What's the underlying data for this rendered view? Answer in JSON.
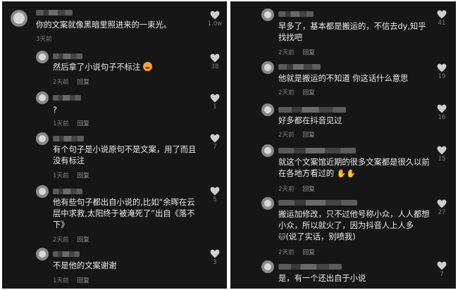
{
  "reply_label": "回复",
  "left_comments": [
    {
      "text": "你的文案就像黑暗里照进来的一束光。",
      "time": "3天前",
      "likes": "1.0w"
    },
    {
      "text": "然后拿了小说句子不标注",
      "time": "2天前",
      "likes": "38"
    },
    {
      "text": "?",
      "time": "1天前",
      "likes": "1"
    },
    {
      "text": "有个句子是小说原句不是文案，用了而且没有标注",
      "time": "1天前",
      "likes": "7"
    },
    {
      "text": "他有些句子都出自小说的,比如“余晖在云层中求救,太阳终于被淹死了”出自《落不下》",
      "time": "2天前",
      "likes": "5"
    },
    {
      "text": "不是他的文案谢谢",
      "time": "1天前",
      "likes": "3"
    }
  ],
  "right_comments": [
    {
      "text": "早多了，基本都是搬运的，不信去dy,知乎找找吧",
      "time": "2天前",
      "likes": "41"
    },
    {
      "text": "他就是搬运的不知道 你这话什么意思",
      "time": "2天前",
      "likes": "19"
    },
    {
      "text": "好多都在抖音见过",
      "time": "2天前",
      "likes": "16"
    },
    {
      "text": "就这个文案馆近期的很多文案都是很久以前在各地方看过的",
      "time": "2天前",
      "likes": "15"
    },
    {
      "text": "搬运加修改，只不过他号称小众，人人都想小众，所以就火了，因为抖音人上人多",
      "text2": "(说了实话，别喷我)",
      "time": "2天前",
      "likes": "27"
    },
    {
      "text": "是，有一个还出自于小说",
      "time": "",
      "likes": "7"
    }
  ]
}
